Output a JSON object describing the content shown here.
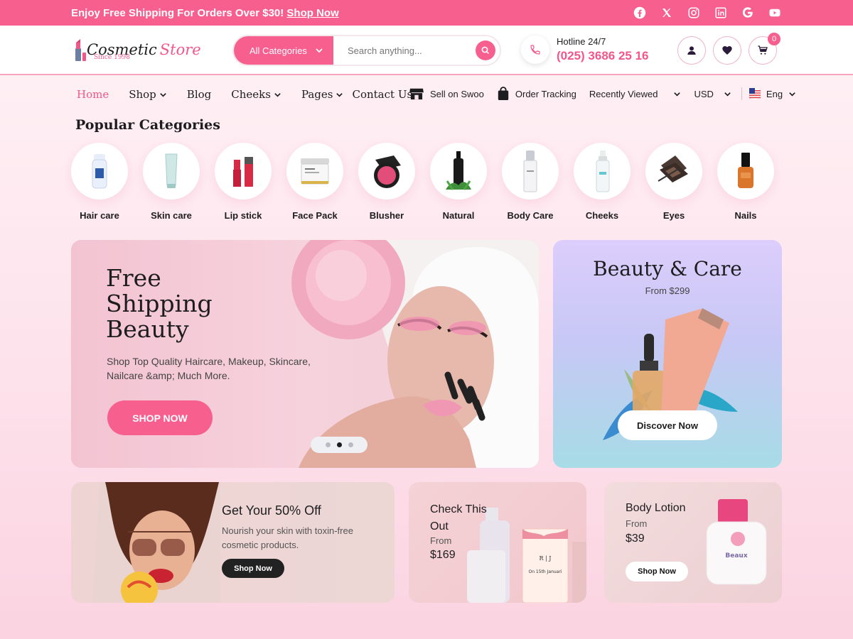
{
  "topbar": {
    "promo_text": "Enjoy Free Shipping For Orders Over $30!",
    "promo_link": "Shop Now",
    "socials": [
      "facebook-icon",
      "x-icon",
      "instagram-icon",
      "linkedin-icon",
      "google-icon",
      "youtube-icon"
    ]
  },
  "header": {
    "logo_part1": "Cosmetic",
    "logo_part2": "Store",
    "logo_since": "Since 1998",
    "category_select": "All Categories",
    "search_placeholder": "Search anything...",
    "hotline_label": "Hotline 24/7",
    "hotline_number": "(025) 3686 25 16",
    "cart_count": "0"
  },
  "nav": {
    "menu": [
      {
        "label": "Home",
        "dropdown": false
      },
      {
        "label": "Shop",
        "dropdown": true
      },
      {
        "label": "Blog",
        "dropdown": false
      },
      {
        "label": "Cheeks",
        "dropdown": true
      },
      {
        "label": "Pages",
        "dropdown": true
      },
      {
        "label": "Contact Us",
        "dropdown": false
      }
    ],
    "sell": "Sell on Swoo",
    "tracking": "Order Tracking",
    "recent": "Recently Viewed",
    "currency": "USD",
    "language": "Eng"
  },
  "categories": {
    "title": "Popular Categories",
    "items": [
      "Hair care",
      "Skin care",
      "Lip stick",
      "Face Pack",
      "Blusher",
      "Natural",
      "Body Care",
      "Cheeks",
      "Eyes",
      "Nails"
    ]
  },
  "hero": {
    "title_l1": "Free",
    "title_l2": "Shipping",
    "title_l3": "Beauty",
    "subtitle": "Shop Top Quality Haircare, Makeup, Skincare, Nailcare &amp; Much More.",
    "button": "SHOP NOW"
  },
  "side_banner": {
    "title": "Beauty & Care",
    "from": "From $299",
    "button": "Discover Now"
  },
  "promo_cards": {
    "card1": {
      "title": "Get Your 50% Off",
      "desc": "Nourish your skin with toxin-free cosmetic products.",
      "button": "Shop Now"
    },
    "card2": {
      "title": "Check This Out",
      "from": "From",
      "price": "$169"
    },
    "card3": {
      "title": "Body Lotion",
      "from": "From",
      "price": "$39",
      "button": "Shop Now"
    }
  },
  "colors": {
    "accent": "#f75f8f",
    "accent_text": "#f2578a",
    "dark": "#1d1d1f"
  }
}
